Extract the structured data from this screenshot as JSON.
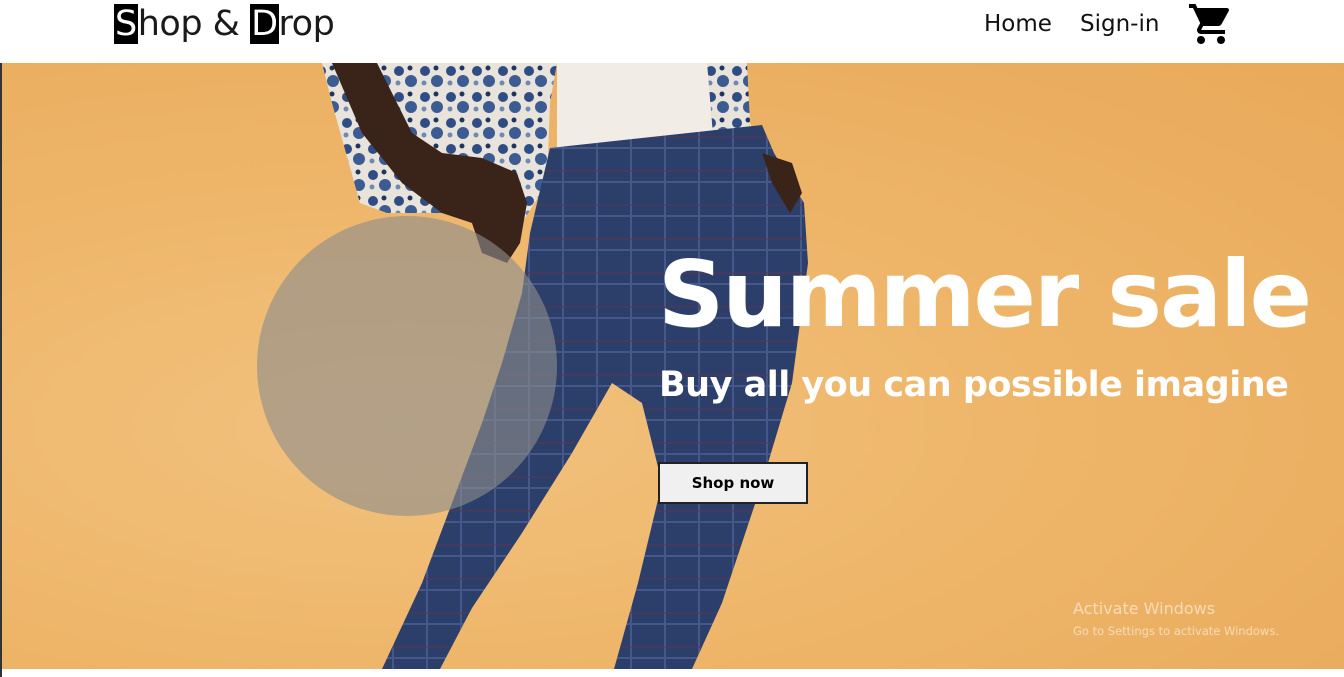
{
  "header": {
    "logo": {
      "first_initial": "S",
      "first_rest": "hop & ",
      "second_initial": "D",
      "second_rest": "rop"
    },
    "nav": {
      "home": "Home",
      "signin": "Sign-in"
    },
    "cart_icon": "shopping-cart-icon"
  },
  "hero": {
    "title": "Summer sale",
    "subtitle": "Buy all you can possible imagine",
    "button": "Shop now"
  },
  "watermark": {
    "line1": "Activate Windows",
    "line2": "Go to Settings to activate Windows."
  },
  "colors": {
    "hero_background": "#eeb66a",
    "trousers": "#2c3f6b",
    "circle_overlay": "#8c8c8c"
  }
}
